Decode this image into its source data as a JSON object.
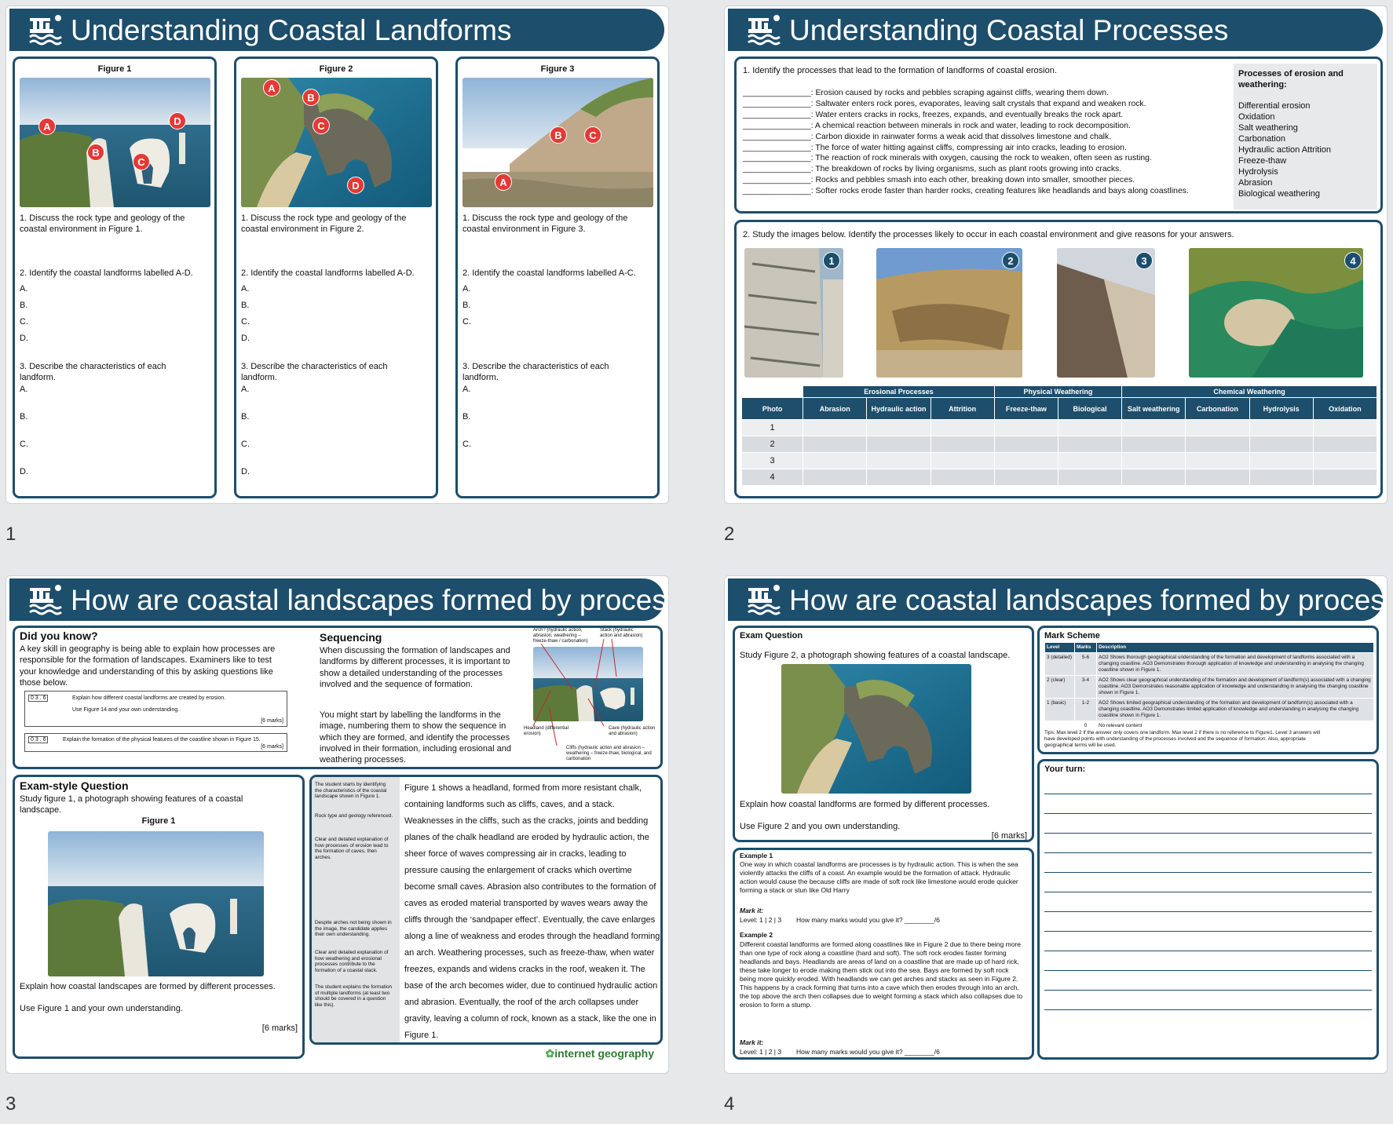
{
  "slide_numbers": [
    "1",
    "2",
    "3",
    "4"
  ],
  "s1": {
    "title": "Understanding Coastal Landforms",
    "cols": [
      {
        "fig": "Figure 1",
        "q1": "1.     Discuss the rock type and geology of the coastal environment in Figure 1.",
        "q2": "2. Identify the coastal landforms labelled A-D.",
        "letters": [
          "A.",
          "B.",
          "C.",
          "D."
        ],
        "q3": "3. Describe the characteristics of each landform.",
        "markers": [
          "A",
          "B",
          "C",
          "D"
        ]
      },
      {
        "fig": "Figure 2",
        "q1": "1.     Discuss the rock type and geology of the coastal environment in Figure 2.",
        "q2": "2. Identify the coastal landforms labelled A-D.",
        "letters": [
          "A.",
          "B.",
          "C.",
          "D."
        ],
        "q3": "3. Describe the characteristics of each landform.",
        "markers": [
          "A",
          "B",
          "C",
          "D"
        ]
      },
      {
        "fig": "Figure 3",
        "q1": "1.     Discuss the rock type and geology of the coastal environment in Figure 3.",
        "q2": "2. Identify the coastal landforms labelled A-C.",
        "letters": [
          "A.",
          "B.",
          "C."
        ],
        "q3": "3. Describe the characteristics of each landform.",
        "markers": [
          "A",
          "B",
          "C"
        ]
      }
    ]
  },
  "s2": {
    "title": "Understanding Coastal Processes",
    "q1": "1.     Identify the processes that lead to the formation of landforms of coastal erosion.",
    "blank": "_______________",
    "items": [
      ": Erosion caused by rocks and pebbles scraping against cliffs, wearing them down.",
      ": Saltwater enters rock pores, evaporates, leaving salt crystals that expand and weaken rock.",
      ": Water enters cracks in rocks, freezes, expands, and eventually breaks the rock apart.",
      ": A chemical reaction between minerals in rock and water, leading to rock decomposition.",
      ": Carbon dioxide in rainwater forms a weak acid that dissolves limestone and chalk.",
      ": The force of water hitting against cliffs, compressing air into cracks, leading to erosion.",
      ": The reaction of rock minerals with oxygen, causing the rock to weaken, often seen as rusting.",
      ": The breakdown of rocks by living organisms, such as plant roots growing into cracks.",
      ": Rocks and pebbles smash into each other, breaking down into smaller, smoother pieces.",
      ": Softer rocks erode faster than harder rocks, creating features like headlands and bays along coastlines."
    ],
    "word_bank_title": "Processes of erosion and weathering:",
    "word_bank": [
      "Differential erosion",
      "Oxidation",
      "Salt weathering",
      "Carbonation",
      "Hydraulic action Attrition",
      "Freeze-thaw",
      "Hydrolysis",
      "Abrasion",
      "Biological weathering"
    ],
    "q2": "2. Study the images below. Identify the processes likely to occur in each coastal environment and give reasons for your answers.",
    "photo_nums": [
      "1",
      "2",
      "3",
      "4"
    ],
    "groups": [
      "Erosional Processes",
      "Physical Weathering",
      "Chemical Weathering"
    ],
    "cols": [
      "Photo",
      "Abrasion",
      "Hydraulic action",
      "Attrition",
      "Freeze-thaw",
      "Biological",
      "Salt weathering",
      "Carbonation",
      "Hydrolysis",
      "Oxidation"
    ],
    "rows": [
      "1",
      "2",
      "3",
      "4"
    ]
  },
  "s3": {
    "title": "How are coastal landscapes formed by processes?",
    "dyk_title": "Did you know?",
    "dyk_text": "A key skill in geography is being able to explain how processes are responsible for the formation of landscapes. Examiners like to test your knowledge and understanding of this by asking questions like those below.",
    "ex1_code": "0 3 . 6",
    "ex1_text": "Explain how different coastal landforms are created by erosion.",
    "ex1_text2": "Use Figure 14 and your own understanding.",
    "ex1_marks": "[6 marks]",
    "ex2_code": "0 3 . 6",
    "ex2_text": "Explain the formation of the physical features of the coastline shown in Figure 15.",
    "ex2_marks": "[6 marks]",
    "seq_title": "Sequencing",
    "seq_p1": "When discussing the formation of landscapes and landforms by different processes, it is important to show a detailed understanding of the processes involved and the sequence of formation.",
    "seq_p2": "You might start by labelling the landforms in the image, numbering them to show the sequence in which they are formed, and identify the processes involved in their formation, including erosional and weathering processes.",
    "labels": {
      "arch": "Arch? (hydraulic action, abrasion, weathering – freeze-thaw / carbonation)",
      "stack": "Stack (hydraulic action and abrasion)",
      "headland": "Headland (differential erosion)",
      "cave": "Cave (hydraulic action and abrasion)",
      "cliffs": "Cliffs (hydraulic action and abrasion – weathering – freeze-thaw, biological, and carbonation"
    },
    "esq_title": "Exam-style Question",
    "esq_text": "Study figure 1, a photograph showing features of a coastal landscape.",
    "esq_fig": "Figure 1",
    "esq_q": "Explain how coastal landscapes are formed by different processes.",
    "esq_use": "Use Figure 1 and your own understanding.",
    "esq_marks": "[6 marks]",
    "notes": [
      "The student starts by identifying the characteristics of the coastal landscape shown in Figure 1.",
      "Rock type and geology referenced.",
      "Clear and detailed explanation of how processes of erosion lead to the formation of caves, then arches.",
      "Despite arches not being shown in the image, the candidate applies their own understanding.",
      "Clear and detailed explanation of how weathering and erosional processes contribute to the formation of a coastal stack.",
      "The student explains the formation of multiple landforms (at least two should be covered in a question like this)."
    ],
    "answer": "Figure 1 shows  a headland, formed from more resistant chalk, containing landforms such as cliffs, caves, and a stack. Weaknesses in the cliffs, such as the cracks, joints and bedding planes of the chalk headland are eroded by hydraulic action, the sheer force of waves compressing air in cracks, leading to pressure causing the enlargement of cracks which overtime become small caves. Abrasion also contributes to the formation of caves as eroded material transported by waves wears away the cliffs through the ‘sandpaper effect’. Eventually, the cave enlarges along a line of weakness and erodes through the headland forming an arch. Weathering processes, such as freeze-thaw, when water freezes, expands and widens cracks in the roof, weaken it. The base of the arch becomes wider, due to continued hydraulic action and abrasion. Eventually, the roof of the arch collapses under gravity, leaving a column of rock, known as a stack, like the one in Figure 1.",
    "brand": "internet geography"
  },
  "s4": {
    "title": "How are coastal landscapes formed by processes?",
    "eq_title": "Exam Question",
    "eq_text": "Study Figure 2, a photograph showing features of a coastal landscape.",
    "eq_q": "Explain how coastal landforms are formed by different processes.",
    "eq_use": "Use Figure 2 and you own understanding.",
    "eq_marks": "[6 marks]",
    "ex1_title": "Example 1",
    "ex1_text": "One way in which coastal landforms are processes is by hydraulic action. This is when the sea violently attacks the cliffs of a coast. An example would be the formation of attack. Hydraulic action would cause the because cliffs are made of soft rock like limestone would erode quicker forming a stack or stun like Old Harry",
    "mark_it": "Mark it:",
    "ex1_mark": "Level: 1 | 2 | 3        How many marks would you give it? ________/6",
    "ex2_title": "Example 2",
    "ex2_text": "Different coastal landforms are formed along coastlines like in Figure 2 due to there being more than one type of rock along a coastline (hard and soft). The soft rock erodes faster forming headlands and bays. Headlands are areas of land on a coastline that are made up of hard rick, these take longer to erode making them stick out into the sea. Bays are formed by soft rock being more quickly eroded. With headlands we can get arches and stacks as seen in Figure 2. This happens by a crack forming that turns into a cave which then erodes through into an arch, the top above the arch then collapses due to weight forming a stack which also collapses due to erosion to form a stump.",
    "ex2_mark": "Level: 1 | 2 | 3        How many marks would you give it? ________/6",
    "ms_title": "Mark Scheme",
    "ms_head": [
      "Level",
      "Marks",
      "Description"
    ],
    "ms_rows": [
      [
        "3 (detailed)",
        "5-6",
        "AO2 Shows thorough geographical understanding of the formation and development of landforms associated with a changing coastline.  AO3 Demonstrates thorough application of knowledge and understanding in analysing the changing coastline shown in Figure 1."
      ],
      [
        "2 (clear)",
        "3-4",
        "AO2 Shows clear geographical understanding of the formation and development of landform(s) associated with a changing coastline.  AO3 Demonstrates reasonable application of knowledge and understanding in analysing the changing coastline shown in Figure 1."
      ],
      [
        "1 (basic)",
        "1-2",
        "AO2 Shows limited geographical understanding of the formation and development of landform(s) associated with a changing coastline. AO3 Demonstrates limited application of knowledge and understanding in analysing the changing coastline shown in Figure 1."
      ],
      [
        "",
        "0",
        "No relevant content"
      ]
    ],
    "tips": "Tips: Max level 2 if the answer only covers one landform. Max level 2 if there is no reference to Figure1. Level 3 answers will have developed points with understanding of the processes involved and the sequence of formation. Also, appropriate geographical terms will be used.",
    "your_turn": "Your turn:"
  }
}
